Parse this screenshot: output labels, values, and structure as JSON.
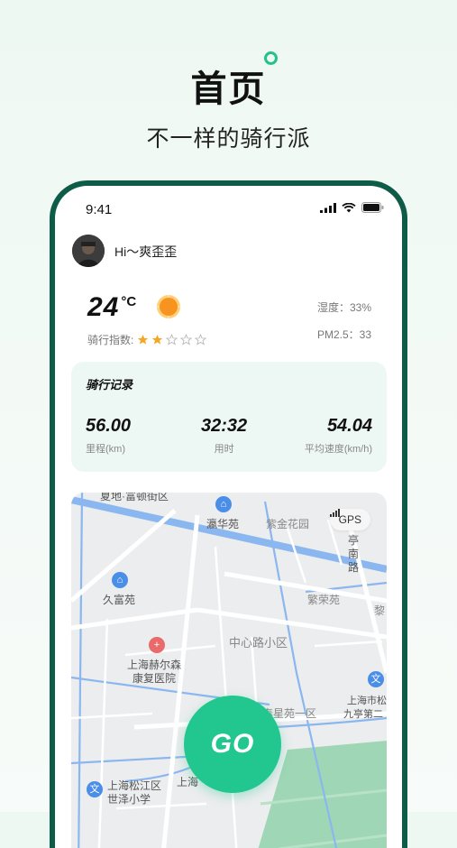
{
  "hero": {
    "title": "首页",
    "subtitle": "不一样的骑行派"
  },
  "status_bar": {
    "time": "9:41"
  },
  "user": {
    "greeting": "Hi～爽歪歪"
  },
  "weather": {
    "temperature": "24",
    "unit": "°C",
    "ride_index_label": "骑行指数:",
    "ride_index_stars": 2,
    "ride_index_max": 5,
    "humidity": "湿度：33%",
    "pm25": "PM2.5：33",
    "sun_color": "#f7931e"
  },
  "ride_record": {
    "title": "骑行记录",
    "stats": [
      {
        "value": "56.00",
        "label": "里程(km)"
      },
      {
        "value": "32:32",
        "label": "用时"
      },
      {
        "value": "54.04",
        "label": "平均速度(km/h)"
      }
    ]
  },
  "map": {
    "gps_label": "GPS",
    "labels": {
      "top_cut": "夏地·富顿街区",
      "lihuayuan": "瀛华苑",
      "zijinhuayuan": "紫金花园",
      "tingnan": "亭南路",
      "jiufuyuan": "久富苑",
      "fanrongyuan": "繁荣苑",
      "zhongxin": "中心路小区",
      "hospital_1": "上海赫尔森",
      "hospital_2": "康复医院",
      "xingyuan": "泰星苑一区",
      "shanghaishi_1": "上海市松",
      "shanghaishi_2": "九亭第二",
      "songjiang": "上海松江区",
      "shize": "世泽小学",
      "shanghai_cut": "上海",
      "li": "黎"
    }
  },
  "go_button": {
    "label": "GO"
  },
  "colors": {
    "accent": "#22c78f",
    "phone_frame": "#0e5c47",
    "card_bg": "#edf8f4",
    "star": "#f5a623"
  }
}
